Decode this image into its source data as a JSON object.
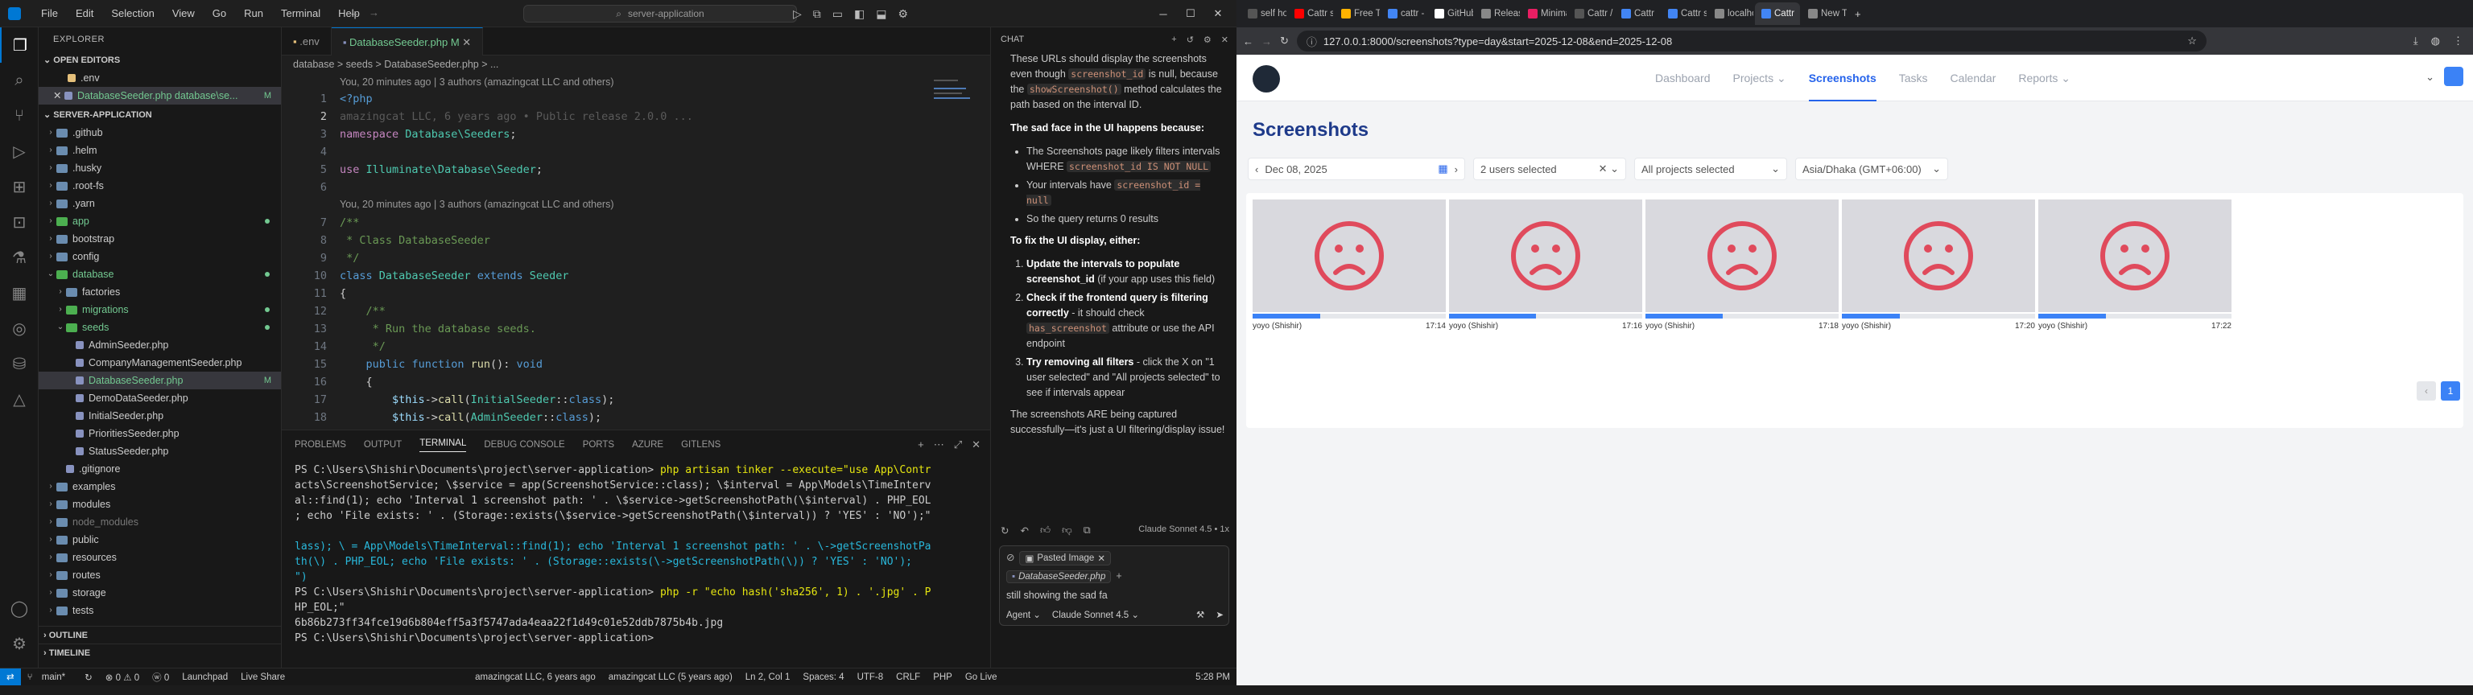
{
  "vscode": {
    "menu": [
      "File",
      "Edit",
      "Selection",
      "View",
      "Go",
      "Run",
      "Terminal",
      "Help"
    ],
    "search": "server-application",
    "explorer_title": "EXPLORER",
    "open_editors_label": "OPEN EDITORS",
    "open_editors": [
      ".env",
      "DatabaseSeeder.php database\\se..."
    ],
    "project_label": "SERVER-APPLICATION",
    "tree": [
      {
        "name": ".github",
        "type": "folder"
      },
      {
        "name": ".helm",
        "type": "folder"
      },
      {
        "name": ".husky",
        "type": "folder"
      },
      {
        "name": ".root-fs",
        "type": "folder"
      },
      {
        "name": ".yarn",
        "type": "folder"
      },
      {
        "name": "app",
        "type": "folder",
        "green": true
      },
      {
        "name": "bootstrap",
        "type": "folder"
      },
      {
        "name": "config",
        "type": "folder"
      },
      {
        "name": "database",
        "type": "folder",
        "green": true,
        "open": true
      },
      {
        "name": "factories",
        "type": "folder",
        "indent": 1
      },
      {
        "name": "migrations",
        "type": "folder",
        "indent": 1,
        "green": true
      },
      {
        "name": "seeds",
        "type": "folder",
        "indent": 1,
        "green": true,
        "open": true
      },
      {
        "name": "AdminSeeder.php",
        "type": "file",
        "indent": 2
      },
      {
        "name": "CompanyManagementSeeder.php",
        "type": "file",
        "indent": 2
      },
      {
        "name": "DatabaseSeeder.php",
        "type": "file",
        "indent": 2,
        "selected": true,
        "badge": "M"
      },
      {
        "name": "DemoDataSeeder.php",
        "type": "file",
        "indent": 2
      },
      {
        "name": "InitialSeeder.php",
        "type": "file",
        "indent": 2
      },
      {
        "name": "PrioritiesSeeder.php",
        "type": "file",
        "indent": 2
      },
      {
        "name": "StatusSeeder.php",
        "type": "file",
        "indent": 2
      },
      {
        "name": ".gitignore",
        "type": "file",
        "indent": 1
      },
      {
        "name": "examples",
        "type": "folder"
      },
      {
        "name": "modules",
        "type": "folder"
      },
      {
        "name": "node_modules",
        "type": "folder",
        "dim": true
      },
      {
        "name": "public",
        "type": "folder"
      },
      {
        "name": "resources",
        "type": "folder"
      },
      {
        "name": "routes",
        "type": "folder"
      },
      {
        "name": "storage",
        "type": "folder"
      },
      {
        "name": "tests",
        "type": "folder"
      }
    ],
    "outline_label": "OUTLINE",
    "timeline_label": "TIMELINE",
    "tabs": [
      ".env",
      "DatabaseSeeder.php M"
    ],
    "breadcrumb": "database > seeds > DatabaseSeeder.php > ...",
    "blame1": "You, 20 minutes ago | 3 authors (amazingcat LLC and others)",
    "ghost_blame": "amazingcat LLC, 6 years ago • Public release 2.0.0 ...",
    "blame2": "You, 20 minutes ago | 3 authors (amazingcat LLC and others)",
    "terminal_tabs": [
      "PROBLEMS",
      "OUTPUT",
      "TERMINAL",
      "DEBUG CONSOLE",
      "PORTS",
      "AZURE",
      "GITLENS"
    ],
    "terminal_lines": [
      "PS C:\\Users\\Shishir\\Documents\\project\\server-application> php artisan tinker --execute=\"use App\\Contr",
      "acts\\ScreenshotService; \\$service = app(ScreenshotService::class); \\$interval = App\\Models\\TimeInterv",
      "al::find(1); echo 'Interval 1 screenshot path: ' . \\$service->getScreenshotPath(\\$interval) . PHP_EOL",
      "; echo 'File exists: ' . (Storage::exists(\\$service->getScreenshotPath(\\$interval)) ? 'YES' : 'NO');\"",
      "",
      "lass); \\ = App\\Models\\TimeInterval::find(1); echo 'Interval 1 screenshot path: ' . \\->getScreenshotPa",
      "th(\\) . PHP_EOL; echo 'File exists: ' . (Storage::exists(\\->getScreenshotPath(\\)) ? 'YES' : 'NO');",
      "\")",
      "PS C:\\Users\\Shishir\\Documents\\project\\server-application> php -r \"echo hash('sha256', 1) . '.jpg' . P",
      "HP_EOL;\"",
      "6b86b273ff34fce19d6b804eff5a3f5747ada4eaa22f1d49c01e52ddb7875b4b.jpg",
      "PS C:\\Users\\Shishir\\Documents\\project\\server-application> "
    ],
    "chat": {
      "title": "CHAT",
      "p1a": "These URLs should display the screenshots even though ",
      "p1b": "screenshot_id",
      "p1c": " is null, because the ",
      "p1d": "showScreenshot()",
      "p1e": " method calculates the path based on the interval ID.",
      "h1": "The sad face in the UI happens because:",
      "b1a": "The Screenshots page likely filters intervals WHERE ",
      "b1b": "screenshot_id IS NOT NULL",
      "b2a": "Your intervals have ",
      "b2b": "screenshot_id = null",
      "b3": "So the query returns 0 results",
      "h2": "To fix the UI display, either:",
      "o1a": "Update the intervals to populate screenshot_id",
      "o1b": " (if your app uses this field)",
      "o2a": "Check if the frontend query is filtering correctly",
      "o2b": " - it should check ",
      "o2c": "has_screenshot",
      "o2d": " attribute or use the API endpoint",
      "o3a": "Try removing all filters",
      "o3b": " - click the X on \"1 user selected\" and \"All projects selected\" to see if intervals appear",
      "p2": "The screenshots ARE being captured successfully—it's just a UI filtering/display issue!",
      "model": "Claude Sonnet 4.5 • 1x",
      "chip1": "Pasted Image",
      "chip2": "DatabaseSeeder.php",
      "input": "still showing the sad fa",
      "agent": "Agent",
      "model2": "Claude Sonnet 4.5"
    },
    "status": {
      "branch": "main*",
      "errors": "⊗ 0 ⚠ 0",
      "ports": "ⓦ 0",
      "launchpad": "Launchpad",
      "liveshare": "Live Share",
      "blame": "amazingcat LLC, 6 years ago",
      "blame2": "amazingcat LLC (5 years ago)",
      "pos": "Ln 2, Col 1",
      "spaces": "Spaces: 4",
      "enc": "UTF-8",
      "eol": "CRLF",
      "lang": "PHP",
      "golive": "Go Live",
      "time": "5:28 PM"
    }
  },
  "browser": {
    "tabs": [
      "self hoste",
      "Cattr self",
      "Free Temp",
      "cattr - Go",
      "GitHub - c",
      "Releases",
      "Minimal r",
      "Cattr / Co",
      "Cattr",
      "Cattr serve",
      "localhost",
      "Cattr",
      "New Tab"
    ],
    "active_tab": 11,
    "url": "127.0.0.1:8000/screenshots?type=day&start=2025-12-08&end=2025-12-08",
    "nav": [
      "Dashboard",
      "Projects",
      "Screenshots",
      "Tasks",
      "Calendar",
      "Reports"
    ],
    "active_nav": 2,
    "title": "Screenshots",
    "date": "Dec 08, 2025",
    "users": "2 users selected",
    "projects": "All projects selected",
    "timezone": "Asia/Dhaka (GMT+06:00)",
    "shots": [
      {
        "user": "yoyo (Shishir)",
        "time": "17:14",
        "progress": 0.35
      },
      {
        "user": "yoyo (Shishir)",
        "time": "17:16",
        "progress": 0.45
      },
      {
        "user": "yoyo (Shishir)",
        "time": "17:18",
        "progress": 0.4
      },
      {
        "user": "yoyo (Shishir)",
        "time": "17:20",
        "progress": 0.3
      },
      {
        "user": "yoyo (Shishir)",
        "time": "17:22",
        "progress": 0.35
      }
    ],
    "page": "1",
    "time": "5:28 PM"
  }
}
